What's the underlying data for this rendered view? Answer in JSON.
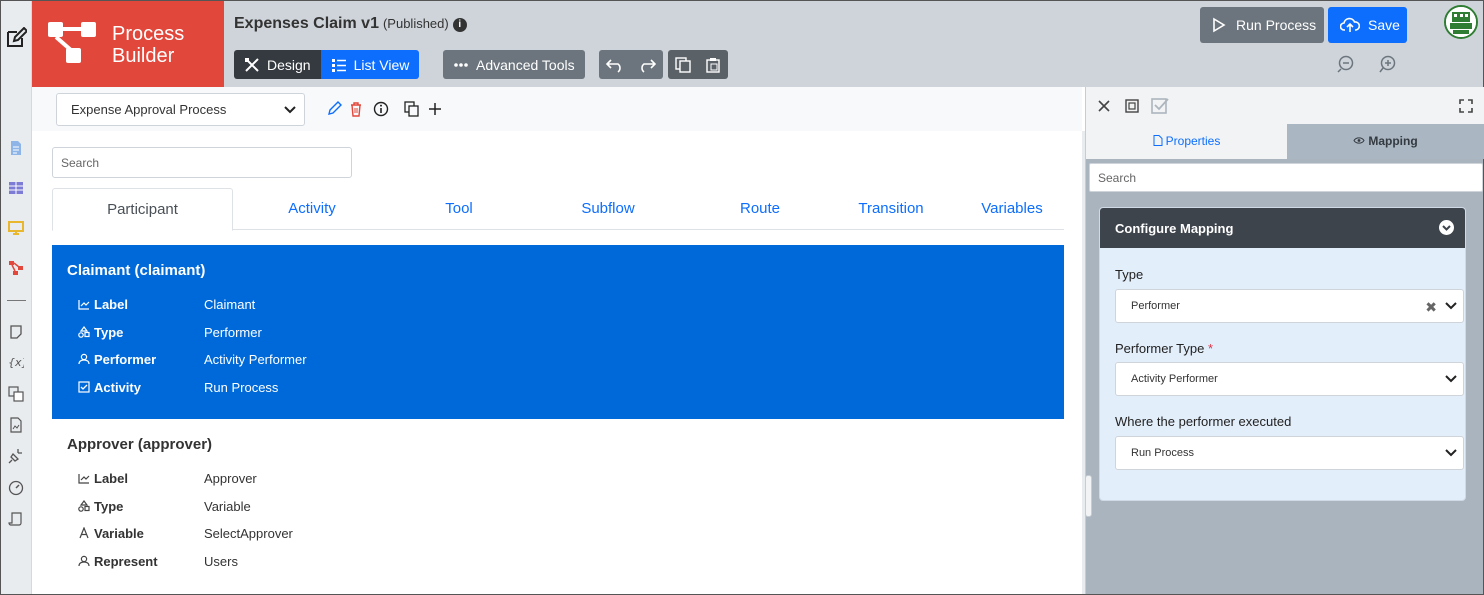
{
  "app": {
    "brand_line1": "Process",
    "brand_line2": "Builder",
    "title": "Expenses Claim v1",
    "status": "(Published)"
  },
  "toolbar": {
    "design": "Design",
    "list_view": "List View",
    "advanced_tools": "Advanced Tools",
    "run_process": "Run Process",
    "save": "Save"
  },
  "process_select": {
    "value": "Expense Approval Process"
  },
  "search": {
    "placeholder": "Search"
  },
  "tabs": [
    "Participant",
    "Activity",
    "Tool",
    "Subflow",
    "Route",
    "Transition",
    "Variables"
  ],
  "participants": [
    {
      "title": "Claimant (claimant)",
      "fields": [
        {
          "key": "Label",
          "value": "Claimant",
          "icon": "label-icon"
        },
        {
          "key": "Type",
          "value": "Performer",
          "icon": "type-icon"
        },
        {
          "key": "Performer",
          "value": "Activity Performer",
          "icon": "user-icon"
        },
        {
          "key": "Activity",
          "value": "Run Process",
          "icon": "checkbox-icon"
        }
      ]
    },
    {
      "title": "Approver (approver)",
      "fields": [
        {
          "key": "Label",
          "value": "Approver",
          "icon": "label-icon"
        },
        {
          "key": "Type",
          "value": "Variable",
          "icon": "type-icon"
        },
        {
          "key": "Variable",
          "value": "SelectApprover",
          "icon": "font-icon"
        },
        {
          "key": "Represent",
          "value": "Users",
          "icon": "user-icon"
        }
      ]
    }
  ],
  "right_panel": {
    "tab_properties": "Properties",
    "tab_mapping": "Mapping",
    "search_placeholder": "Search",
    "card_title": "Configure Mapping",
    "type_label": "Type",
    "type_value": "Performer",
    "performer_type_label": "Performer Type",
    "required_mark": "*",
    "performer_type_value": "Activity Performer",
    "where_label": "Where the performer executed",
    "where_value": "Run Process"
  },
  "colors": {
    "brand": "#e1473b",
    "primary": "#0d6efd",
    "selected_card": "#0069d9",
    "header_bg": "#ced4da"
  }
}
